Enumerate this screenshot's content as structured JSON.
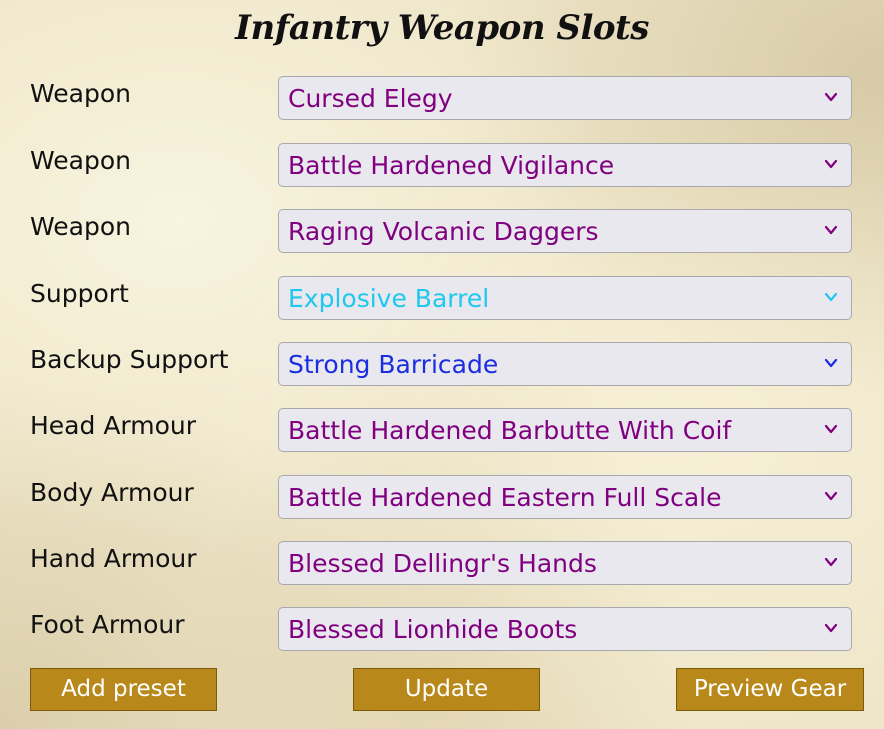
{
  "title": "Infantry Weapon Slots",
  "slots": [
    {
      "label": "Weapon",
      "value": "Cursed Elegy",
      "color": "#800080"
    },
    {
      "label": "Weapon",
      "value": "Battle Hardened Vigilance",
      "color": "#800080"
    },
    {
      "label": "Weapon",
      "value": "Raging Volcanic Daggers",
      "color": "#800080"
    },
    {
      "label": "Support",
      "value": "Explosive Barrel",
      "color": "#1ec8f0"
    },
    {
      "label": "Backup Support",
      "value": "Strong Barricade",
      "color": "#1a2ee0"
    },
    {
      "label": "Head Armour",
      "value": "Battle Hardened Barbutte With Coif",
      "color": "#800080"
    },
    {
      "label": "Body Armour",
      "value": "Battle Hardened Eastern Full Scale",
      "color": "#800080"
    },
    {
      "label": "Hand Armour",
      "value": "Blessed Dellingr's Hands",
      "color": "#800080"
    },
    {
      "label": "Foot Armour",
      "value": "Blessed Lionhide Boots",
      "color": "#800080"
    }
  ],
  "buttons": {
    "add_preset": "Add preset",
    "update": "Update",
    "preview_gear": "Preview Gear"
  },
  "colors": {
    "button_bg": "#b8891a",
    "chevron_default": "#800080"
  }
}
